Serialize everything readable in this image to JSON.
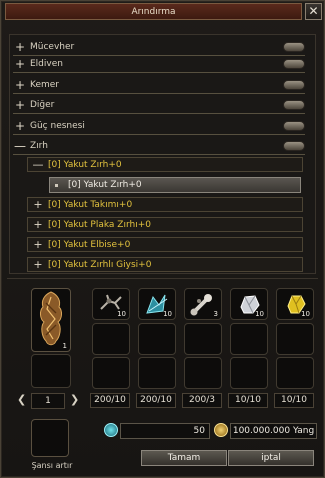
{
  "window": {
    "title": "Arındırma",
    "close_symbol": "✕"
  },
  "categories": [
    {
      "sign": "+",
      "label": "Mücevher"
    },
    {
      "sign": "+",
      "label": "Eldiven"
    },
    {
      "sign": "+",
      "label": "Kemer"
    },
    {
      "sign": "+",
      "label": "Diğer"
    },
    {
      "sign": "+",
      "label": "Güç nesnesi"
    },
    {
      "sign": "—",
      "label": "Zırh"
    }
  ],
  "subgroups": [
    {
      "sign": "—",
      "label": "[0] Yakut Zırh+0"
    },
    {
      "sign": "+",
      "label": "[0] Yakut Takımı+0"
    },
    {
      "sign": "+",
      "label": "[0] Yakut Plaka Zırhı+0"
    },
    {
      "sign": "+",
      "label": "[0] Yakut Elbise+0"
    },
    {
      "sign": "+",
      "label": "[0] Yakut Zırhlı Giysi+0"
    }
  ],
  "selected_item": "[0] Yakut Zırh+0",
  "main_slot_count": "1",
  "material_slots": [
    {
      "icon": "claw-material-icon",
      "count": "10",
      "ratio": "200/10"
    },
    {
      "icon": "blue-crystal-material-icon",
      "count": "10",
      "ratio": "200/10"
    },
    {
      "icon": "bone-material-icon",
      "count": "3",
      "ratio": "200/3"
    },
    {
      "icon": "silver-ore-icon",
      "count": "10",
      "ratio": "10/10"
    },
    {
      "icon": "gold-gem-icon",
      "count": "10",
      "ratio": "10/10"
    }
  ],
  "page_number": "1",
  "luck_label": "Şansı artır",
  "amount_value": "50",
  "cost_value": "100.000.000 Yang",
  "buttons": {
    "ok": "Tamam",
    "cancel": "iptal"
  },
  "colors": {
    "gold_text": "#e2c23e",
    "title_bar": "#5a2a1c"
  }
}
